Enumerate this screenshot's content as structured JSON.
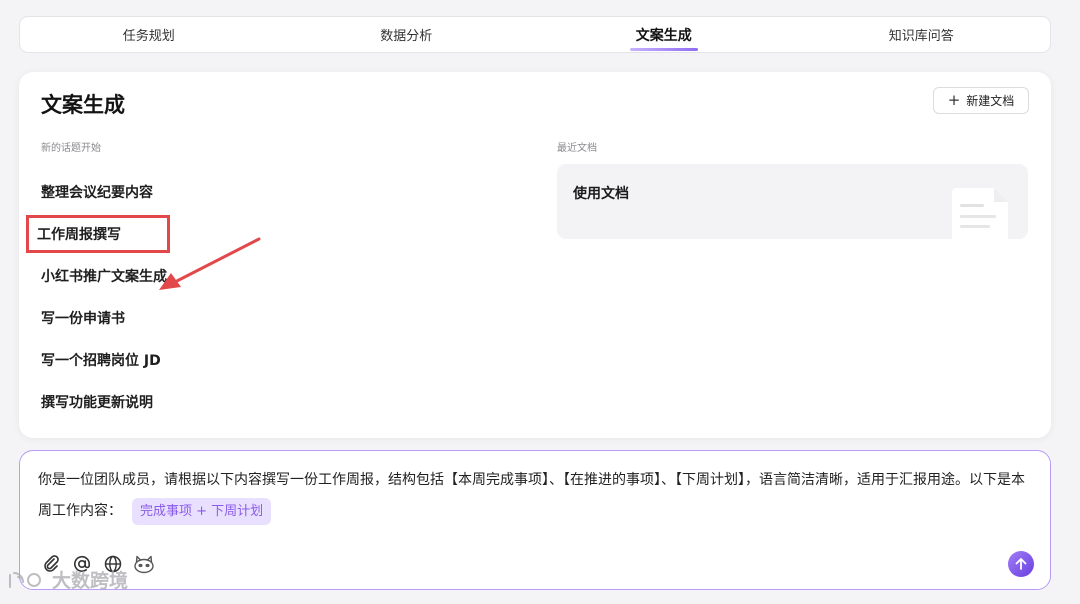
{
  "tabs": [
    {
      "label": "任务规划"
    },
    {
      "label": "数据分析"
    },
    {
      "label": "文案生成"
    },
    {
      "label": "知识库问答"
    }
  ],
  "card": {
    "title": "文案生成",
    "new_doc_label": "新建文档",
    "topics_heading": "新的话题开始",
    "recent_heading": "最近文档",
    "topics": [
      {
        "label": "整理会议纪要内容"
      },
      {
        "label": "工作周报撰写"
      },
      {
        "label": "小红书推广文案生成"
      },
      {
        "label": "写一份申请书"
      },
      {
        "label": "写一个招聘岗位 JD"
      },
      {
        "label": "撰写功能更新说明"
      }
    ],
    "recent_docs": [
      {
        "name": "使用文档"
      }
    ]
  },
  "prompt": {
    "text": "你是一位团队成员，请根据以下内容撰写一份工作周报，结构包括【本周完成事项】、【在推进的事项】、【下周计划】，语言简洁清晰，适用于汇报用途。以下是本周工作内容：",
    "chip": "完成事项 + 下周计划"
  },
  "toolbar": {
    "icons": [
      "paperclip-icon",
      "at-icon",
      "globe-icon",
      "mascot-icon"
    ]
  },
  "watermark": {
    "text": "大数跨境"
  },
  "colors": {
    "accent": "#8e6cf0",
    "highlight_box": "#e2484a",
    "chip_bg": "#e9dfff",
    "chip_text": "#8a5be8"
  }
}
